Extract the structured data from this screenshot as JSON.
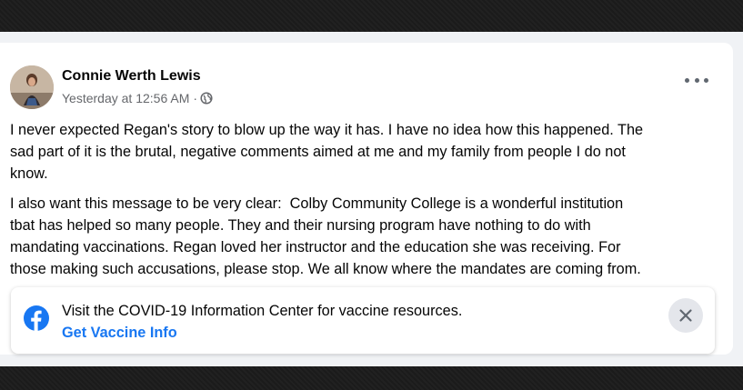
{
  "post": {
    "author": "Connie Werth Lewis",
    "timestamp": "Yesterday at 12:56 AM",
    "separator": "·",
    "privacy_icon": "globe-icon",
    "more_icon": "more-options-icon",
    "paragraphs": [
      [
        "I never expected Regan's story to blow up the way it has. I have no idea how this happened. The",
        "sad part of it is the brutal, negative comments aimed at me and my family from people I do not",
        "know."
      ],
      [
        "I also want this message to be very clear:  Colby Community College is a wonderful institution",
        "tbat has helped so many people. They and their nursing program have nothing to do with",
        "mandating vaccinations. Regan loved her instructor and the education she was receiving. For",
        "those making such accusations, please stop. We all know where the mandates are coming from."
      ]
    ]
  },
  "info_center": {
    "icon": "facebook-icon",
    "message": "Visit the COVID-19 Information Center for vaccine resources.",
    "link_label": "Get Vaccine Info",
    "close_icon": "close-icon"
  },
  "colors": {
    "link_blue": "#1877f2",
    "text_primary": "#050505",
    "text_secondary": "#65676b"
  }
}
